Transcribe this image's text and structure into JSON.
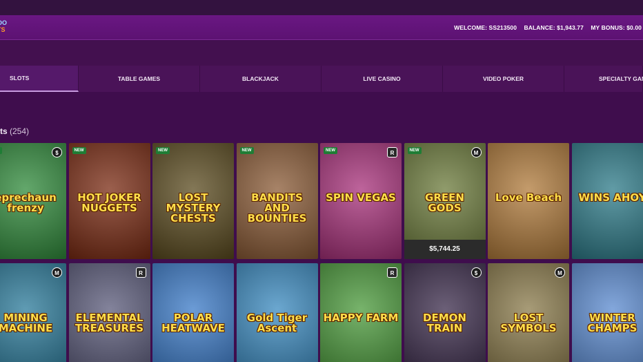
{
  "header": {
    "logo_top": "OO",
    "logo_bottom": "TS",
    "welcome": "WELCOME: SS213500",
    "balance": "BALANCE: $1,943.77",
    "bonus": "MY BONUS: $0.00"
  },
  "tabs": [
    {
      "label": "SLOTS"
    },
    {
      "label": "TABLE GAMES"
    },
    {
      "label": "BLACKJACK"
    },
    {
      "label": "LIVE CASINO"
    },
    {
      "label": "VIDEO POKER"
    },
    {
      "label": "SPECIALTY GAM"
    }
  ],
  "section": {
    "title": "ts",
    "count": "(254)"
  },
  "row1": [
    {
      "title": "eprechaun frenzy",
      "new": "NEW",
      "provider": "$",
      "bg": "#2f8a3a"
    },
    {
      "title": "HOT JOKER NUGGETS",
      "new": "NEW",
      "provider": "",
      "bg": "#7a2a12"
    },
    {
      "title": "LOST MYSTERY CHESTS",
      "new": "NEW",
      "provider": "",
      "bg": "#5a4a1e"
    },
    {
      "title": "BANDITS AND BOUNTIES",
      "new": "NEW",
      "provider": "",
      "bg": "#8a5a35"
    },
    {
      "title": "SPIN VEGAS",
      "new": "NEW",
      "provider": "R",
      "bg": "#a8307a"
    },
    {
      "title": "GREEN GODS",
      "new": "NEW",
      "provider": "M",
      "bg": "#6b7a3a",
      "jackpot": "$5,744.25"
    },
    {
      "title": "Love Beach",
      "new": "",
      "provider": "",
      "bg": "#b07a3a"
    },
    {
      "title": "WINS AHOY",
      "new": "",
      "provider": "",
      "bg": "#2c7a88"
    }
  ],
  "row2": [
    {
      "title": "MINING MACHINE",
      "provider": "M",
      "bg": "#2a7a9a"
    },
    {
      "title": "ELEMENTAL TREASURES",
      "provider": "R",
      "bg": "#5a5a7a"
    },
    {
      "title": "POLAR HEATWAVE",
      "provider": "",
      "bg": "#3a7ac8"
    },
    {
      "title": "Gold Tiger Ascent",
      "provider": "",
      "bg": "#3a8ac0"
    },
    {
      "title": "HAPPY FARM",
      "provider": "R",
      "bg": "#4a9a3a"
    },
    {
      "title": "DEMON TRAIN",
      "provider": "$",
      "bg": "#3a2a4a"
    },
    {
      "title": "LOST SYMBOLS",
      "provider": "M",
      "bg": "#8a7a4a"
    },
    {
      "title": "WINTER CHAMPS",
      "provider": "",
      "bg": "#5a8ad0"
    }
  ]
}
